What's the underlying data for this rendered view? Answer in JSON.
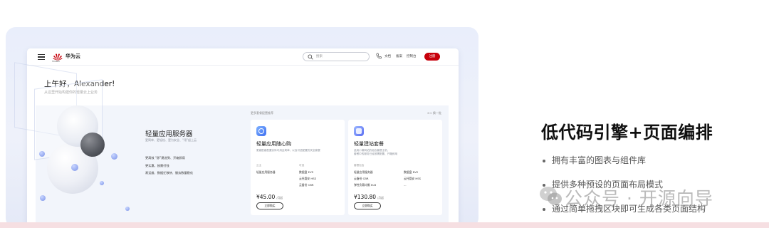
{
  "header": {
    "brand": "华为云",
    "brand_sub": "HUAWEI",
    "search_placeholder": "搜索",
    "links": [
      "文档",
      "备案",
      "控制台"
    ],
    "register": "注册"
  },
  "greeting": {
    "title": "上午好，Alexander!",
    "subtitle": "从这里开始构建你的轻量云上业务"
  },
  "product": {
    "title": "轻量应用服务器",
    "desc": "更简单、更轻松、更为安全、“用”起上云",
    "features": [
      "更高效 “即”建选到、开箱即用",
      "更实惠，按需付钱",
      "易运维、数据迁移快、服务数量稳化"
    ]
  },
  "recommend": {
    "heading": "更多套餐配置推荐",
    "more": "⊙⊃ 换一批",
    "cards": [
      {
        "icon_color": "#4f8cf7",
        "title": "轻量应用随心购",
        "desc": "更高配高配置实际可用且简单、以及可选配置的安全套餐",
        "left_label": "云主",
        "left_value": "轻量应用服务器",
        "right_label": "可选",
        "right_values": [
          "数据盘 EVS",
          "云托管安 HSS",
          "云备份 CBR"
        ],
        "price": "¥45.00",
        "unit": "/月起",
        "button": "立即购买"
      },
      {
        "icon_color": "#5b7cf5",
        "title": "轻量建站套餐",
        "desc": "适用小微网站的组合套餐主机，\n套餐中的服务已经按需配置、开箱即用",
        "left_label": "套餐包含",
        "left_values": [
          "轻量应用服务器",
          "云备份 CBR",
          "弹性负载均衡 ELB"
        ],
        "right_label": "",
        "right_values": [
          "数据盘 EVS",
          "云托管安 HSS",
          "..."
        ],
        "price": "¥130.80",
        "unit": "/月起",
        "button": "立即购买"
      }
    ]
  },
  "side": {
    "title": "低代码引擎+页面编排",
    "bullets": [
      "拥有丰富的图表与组件库",
      "提供多种预设的页面布局模式",
      "通过简单拖拽区块即可生成各类页面结构"
    ]
  },
  "watermark": "公众号 · 开源向导",
  "colors": {
    "accent": "#c7000b",
    "banner": "#f2f5fb",
    "stage": "#e9eefb"
  }
}
